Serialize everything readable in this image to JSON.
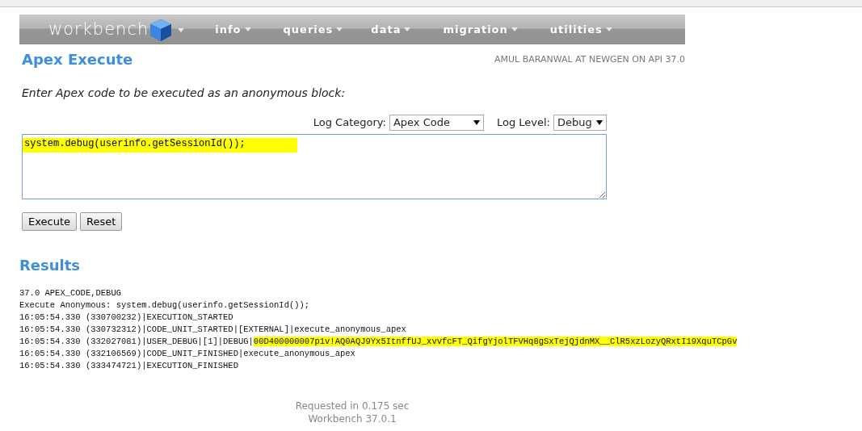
{
  "nav": {
    "brand": "workbench",
    "items": [
      {
        "label": "info"
      },
      {
        "label": "queries"
      },
      {
        "label": "data"
      },
      {
        "label": "migration"
      },
      {
        "label": "utilities"
      }
    ]
  },
  "page": {
    "title": "Apex Execute",
    "user_info": "AMUL BARANWAL AT NEWGEN ON API 37.0"
  },
  "form": {
    "instruction": "Enter Apex code to be executed as an anonymous block:",
    "log_category": {
      "label": "Log Category:",
      "value": "Apex Code"
    },
    "log_level": {
      "label": "Log Level:",
      "value": "Debug"
    },
    "code": {
      "value": "system.debug(userinfo.getSessionId());",
      "highlighted": true
    },
    "buttons": [
      "Execute",
      "Reset"
    ]
  },
  "results": {
    "title": "Results",
    "lines": [
      {
        "text": "37.0 APEX_CODE,DEBUG"
      },
      {
        "text": "Execute Anonymous: system.debug(userinfo.getSessionId());"
      },
      {
        "text": "16:05:54.330 (330700232)|EXECUTION_STARTED"
      },
      {
        "text": "16:05:54.330 (330732312)|CODE_UNIT_STARTED|[EXTERNAL]|execute_anonymous_apex"
      },
      {
        "text": "16:05:54.330 (332027081)|USER_DEBUG|[1]|DEBUG|",
        "highlight": "00D400000007p1v!AQ0AQJ9Yx5ItnffUJ_xvvfcFT_QifgYjolTFVHq8gSxTejQjdnMX__ClR5xzLozyQRxtI19XquTCpGv"
      },
      {
        "text": "16:05:54.330 (332106569)|CODE_UNIT_FINISHED|execute_anonymous_apex"
      },
      {
        "text": "16:05:54.330 (333474721)|EXECUTION_FINISHED"
      }
    ]
  },
  "footer": {
    "timing": "Requested in 0.175 sec",
    "version": "Workbench 37.0.1"
  }
}
